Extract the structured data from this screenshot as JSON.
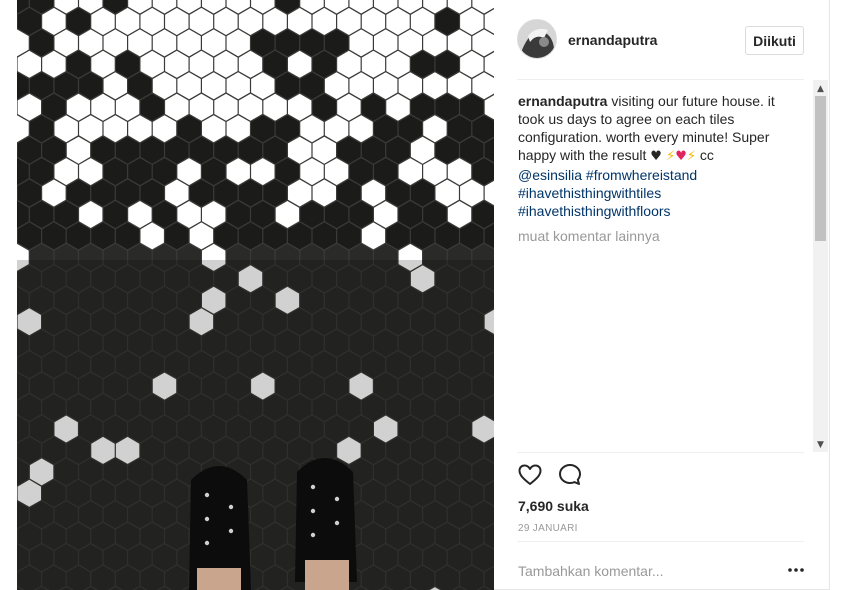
{
  "post": {
    "username": "ernandaputra",
    "follow_label": "Diikuti",
    "caption": {
      "username": "ernandaputra",
      "text": "visiting our future house. it took us days to agree on each tiles configuration. worth every minute! Super happy with the result",
      "emoji_black_heart": "♥",
      "emoji_bolt": "⚡",
      "emoji_red_heart": "♥",
      "suffix": "cc",
      "mention": "@esinsilia",
      "hashtags": [
        "#fromwhereistand",
        "#ihavethisthingwithtiles",
        "#ihavethisthingwithfloors"
      ]
    },
    "load_more_comments": "muat komentar lainnya",
    "likes": "7,690 suka",
    "date": "29 JANUARI",
    "comment_placeholder": "Tambahkan komentar...",
    "icons": {
      "like": "heart-icon",
      "comment": "comment-icon",
      "more": "more-options-icon",
      "scroll_up": "scroll-up-arrow-icon",
      "scroll_down": "scroll-down-arrow-icon"
    },
    "colors": {
      "link": "#003569",
      "muted": "#999999",
      "text": "#262626",
      "tile_black": "#1b1c1a",
      "tile_white": "#ffffff"
    }
  }
}
